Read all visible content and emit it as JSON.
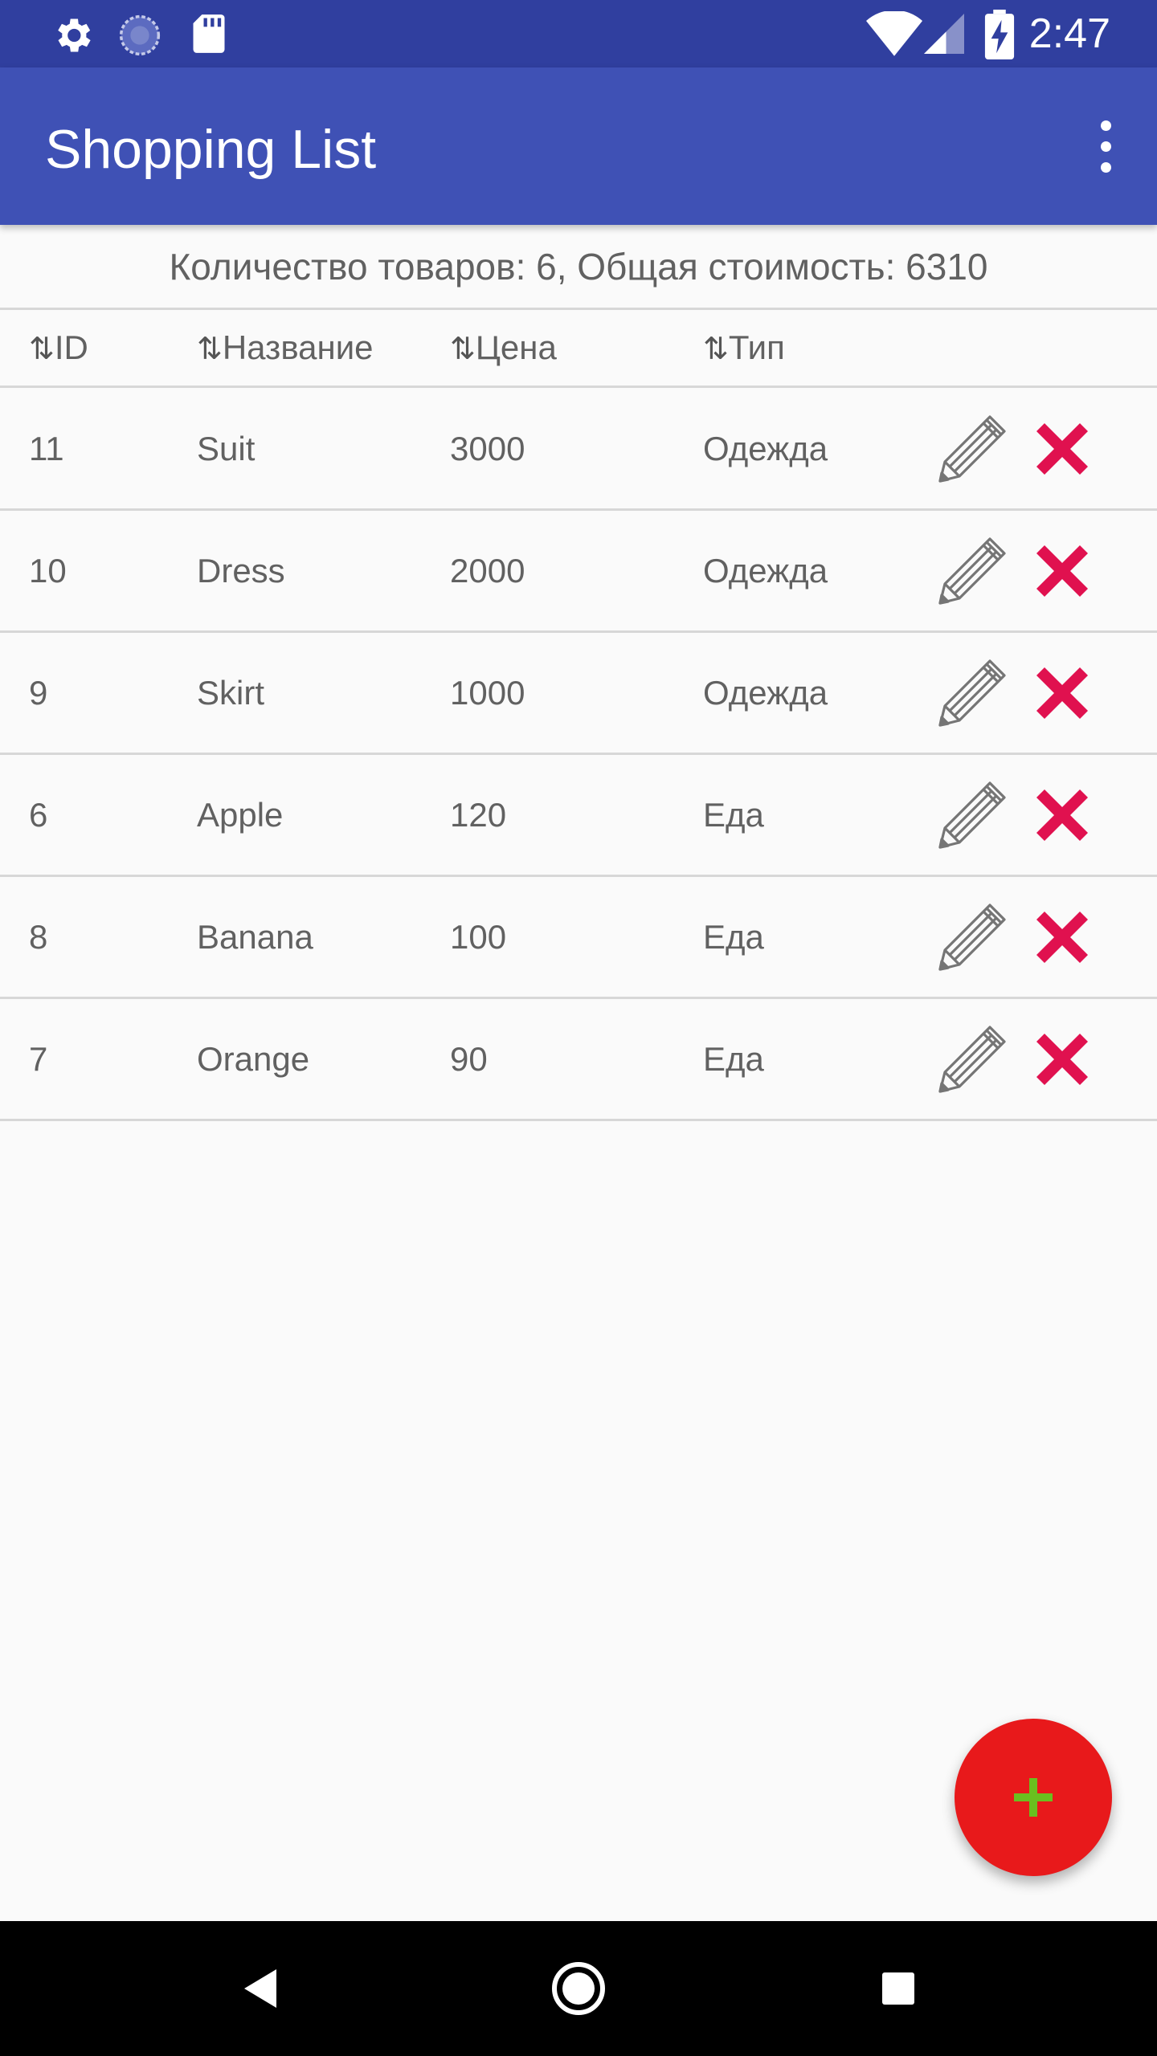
{
  "status_bar": {
    "time": "2:47",
    "icons": [
      "settings-icon",
      "sync-icon",
      "sd-card-icon",
      "wifi-icon",
      "signal-icon",
      "battery-charging-icon"
    ]
  },
  "app_bar": {
    "title": "Shopping List",
    "menu_icon": "more-vert-icon"
  },
  "summary": {
    "text": "Количество товаров: 6, Общая стоимость: 6310"
  },
  "table": {
    "columns": [
      {
        "sort_icon": "⇅",
        "label": "ID"
      },
      {
        "sort_icon": "⇅",
        "label": "Название"
      },
      {
        "sort_icon": "⇅",
        "label": "Цена"
      },
      {
        "sort_icon": "⇅",
        "label": "Тип"
      }
    ],
    "rows": [
      {
        "id": "11",
        "name": "Suit",
        "price": "3000",
        "type": "Одежда"
      },
      {
        "id": "10",
        "name": "Dress",
        "price": "2000",
        "type": "Одежда"
      },
      {
        "id": "9",
        "name": "Skirt",
        "price": "1000",
        "type": "Одежда"
      },
      {
        "id": "6",
        "name": "Apple",
        "price": "120",
        "type": "Еда"
      },
      {
        "id": "8",
        "name": "Banana",
        "price": "100",
        "type": "Еда"
      },
      {
        "id": "7",
        "name": "Orange",
        "price": "90",
        "type": "Еда"
      }
    ],
    "row_actions": [
      "edit-pencil-icon",
      "delete-x-icon"
    ]
  },
  "fab": {
    "icon": "plus-icon"
  },
  "nav_bar": {
    "buttons": [
      "back-icon",
      "home-icon",
      "recents-icon"
    ]
  },
  "colors": {
    "status_bar": "#303f9f",
    "app_bar": "#3f51b5",
    "delete": "#e0114f",
    "fab": "#e8191b",
    "fab_plus": "#6abf1f"
  }
}
